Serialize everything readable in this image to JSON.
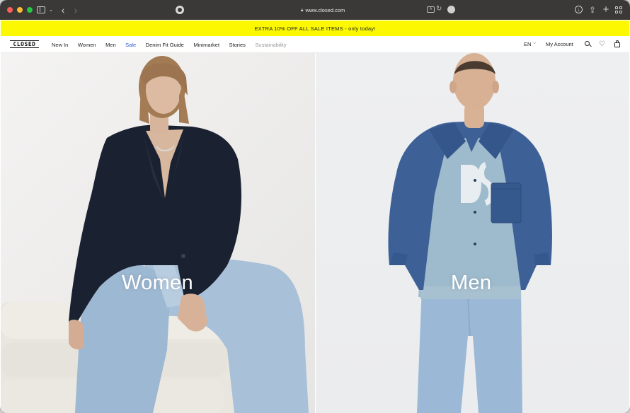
{
  "browser": {
    "url": "www.closed.com",
    "icons": [
      "sidebar-icon",
      "chevron-down-icon",
      "back-icon",
      "forward-icon",
      "privacy-report-icon",
      "lock-icon",
      "translate-icon",
      "reload-icon",
      "extension-icon",
      "download-icon",
      "share-icon",
      "new-tab-icon",
      "tab-overview-icon"
    ]
  },
  "promo": {
    "text": "EXTRA 10% OFF ALL SALE ITEMS - only today!",
    "background": "#fcf802"
  },
  "nav": {
    "logo": "CLOSED",
    "links": [
      {
        "label": "New In"
      },
      {
        "label": "Women"
      },
      {
        "label": "Men"
      },
      {
        "label": "Sale",
        "color": "#2c5bd4"
      },
      {
        "label": "Denim Fit Guide"
      },
      {
        "label": "Minimarket"
      },
      {
        "label": "Stories"
      },
      {
        "label": "Sustainability",
        "color": "#9a9a9a"
      }
    ],
    "language": "EN",
    "account": "My Account",
    "icons": [
      "search-icon",
      "heart-icon",
      "bag-icon"
    ]
  },
  "hero": {
    "women": {
      "title": "Women"
    },
    "men": {
      "title": "Men"
    }
  }
}
